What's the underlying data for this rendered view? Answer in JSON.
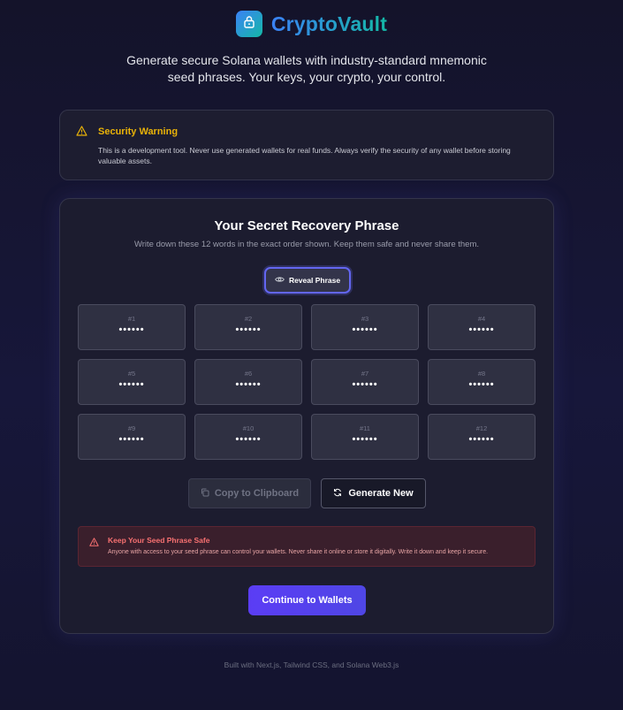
{
  "header": {
    "brand": "CryptoVault",
    "tagline": "Generate secure Solana wallets with industry-standard mnemonic seed phrases. Your keys, your crypto, your control.",
    "logo_icon": "lock-icon"
  },
  "security_warning": {
    "title": "Security Warning",
    "text": "This is a development tool. Never use generated wallets for real funds. Always verify the security of any wallet before storing valuable assets.",
    "icon": "warning-triangle-icon",
    "color": "#eab308"
  },
  "phrase_card": {
    "title": "Your Secret Recovery Phrase",
    "subtitle": "Write down these 12 words in the exact order shown. Keep them safe and never share them.",
    "reveal_label": "Reveal Phrase",
    "reveal_icon": "eye-icon",
    "words": [
      {
        "num": "#1",
        "value": "••••••"
      },
      {
        "num": "#2",
        "value": "••••••"
      },
      {
        "num": "#3",
        "value": "••••••"
      },
      {
        "num": "#4",
        "value": "••••••"
      },
      {
        "num": "#5",
        "value": "••••••"
      },
      {
        "num": "#6",
        "value": "••••••"
      },
      {
        "num": "#7",
        "value": "••••••"
      },
      {
        "num": "#8",
        "value": "••••••"
      },
      {
        "num": "#9",
        "value": "••••••"
      },
      {
        "num": "#10",
        "value": "••••••"
      },
      {
        "num": "#11",
        "value": "••••••"
      },
      {
        "num": "#12",
        "value": "••••••"
      }
    ],
    "copy_label": "Copy to Clipboard",
    "copy_icon": "copy-icon",
    "generate_label": "Generate New",
    "generate_icon": "refresh-icon"
  },
  "safety_notice": {
    "title": "Keep Your Seed Phrase Safe",
    "text": "Anyone with access to your seed phrase can control your wallets. Never share it online or store it digitally. Write it down and keep it secure.",
    "icon": "alert-triangle-icon",
    "color": "#f87171"
  },
  "continue_label": "Continue to Wallets",
  "accent_color": "#6366f1",
  "footer": "Built with Next.js, Tailwind CSS, and Solana Web3.js"
}
